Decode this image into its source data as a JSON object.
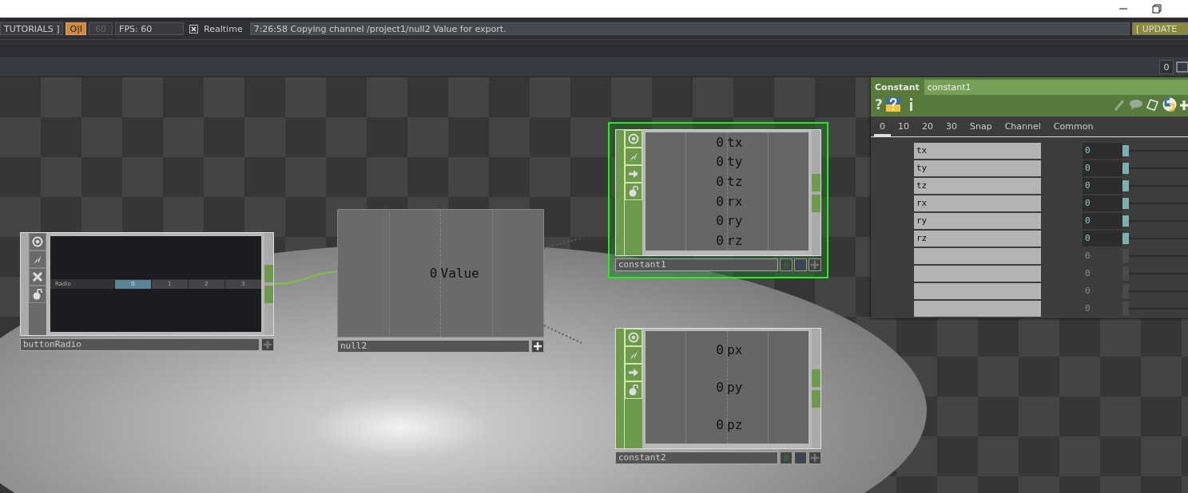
{
  "titlebar": {
    "buttons": [
      {
        "kind": "minimize"
      },
      {
        "kind": "restore"
      }
    ]
  },
  "toolbar": {
    "tutorials": "TUTORIALS ]",
    "perform_button": "O|I",
    "frame_field": "60",
    "fps": "FPS:  60",
    "realtime": {
      "label": "Realtime",
      "checked": true
    },
    "message": "7:26:58 Copying channel /project1/null2 Value for export.",
    "update_button": "[ UPDATE"
  },
  "pathbar": {
    "zoom_button": "0"
  },
  "nodes": [
    {
      "kind": "button",
      "name": "buttonRadio",
      "selected": false,
      "radio_label": "Radio",
      "options": [
        {
          "label": "0",
          "selected": true
        },
        {
          "label": "1",
          "selected": false
        },
        {
          "label": "2",
          "selected": false
        },
        {
          "label": "3",
          "selected": false
        }
      ]
    },
    {
      "kind": "null",
      "name": "null2",
      "selected": false,
      "channels": [
        {
          "value": "0",
          "name": "Value"
        }
      ]
    },
    {
      "kind": "constant",
      "name": "constant1",
      "selected": true,
      "channels": [
        {
          "value": "0",
          "name": "tx"
        },
        {
          "value": "0",
          "name": "ty"
        },
        {
          "value": "0",
          "name": "tz"
        },
        {
          "value": "0",
          "name": "rx"
        },
        {
          "value": "0",
          "name": "ry"
        },
        {
          "value": "0",
          "name": "rz"
        }
      ]
    },
    {
      "kind": "constant",
      "name": "constant2",
      "selected": false,
      "channels": [
        {
          "value": "0",
          "name": "px"
        },
        {
          "value": "0",
          "name": "py"
        },
        {
          "value": "0",
          "name": "pz"
        }
      ]
    }
  ],
  "parameters": {
    "type": "Constant",
    "name": "constant1",
    "help": "?",
    "tabs": [
      {
        "label": "0",
        "selected": true
      },
      {
        "label": "10",
        "selected": false
      },
      {
        "label": "20",
        "selected": false
      },
      {
        "label": "30",
        "selected": false
      },
      {
        "label": "Snap",
        "selected": false
      },
      {
        "label": "Channel",
        "selected": false
      },
      {
        "label": "Common",
        "selected": false
      }
    ],
    "rows": [
      {
        "name": "tx",
        "value": "0",
        "active": true,
        "level": 0
      },
      {
        "name": "ty",
        "value": "0",
        "active": true,
        "level": 0
      },
      {
        "name": "tz",
        "value": "0",
        "active": true,
        "level": 0
      },
      {
        "name": "rx",
        "value": "0",
        "active": true,
        "level": 0
      },
      {
        "name": "ry",
        "value": "0",
        "active": true,
        "level": 0
      },
      {
        "name": "rz",
        "value": "0",
        "active": true,
        "level": 0
      },
      {
        "value": "0",
        "active": false,
        "level": 0
      },
      {
        "value": "0",
        "active": false,
        "level": 0
      },
      {
        "value": "0",
        "active": false,
        "level": 0
      },
      {
        "value": "0",
        "active": false,
        "level": 0
      }
    ]
  }
}
